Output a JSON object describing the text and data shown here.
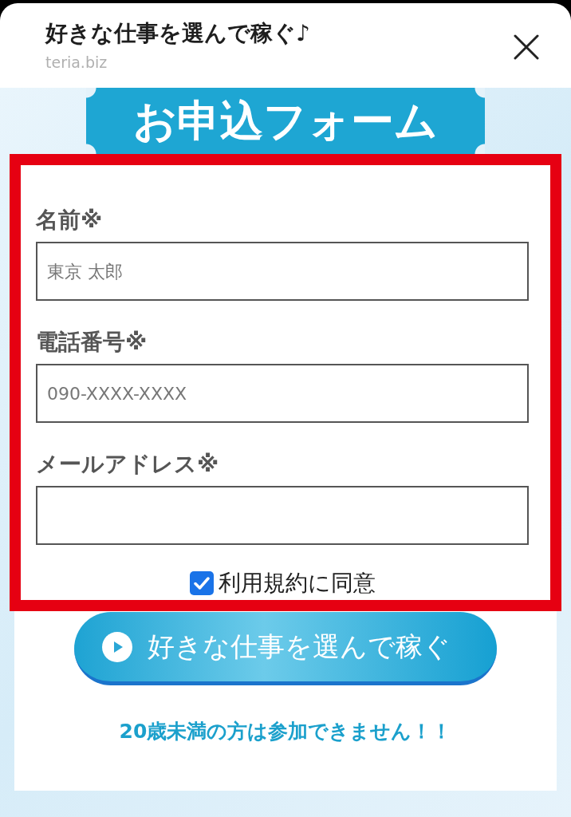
{
  "sheet": {
    "title": "好きな仕事を選んで稼ぐ♪",
    "url": "teria.biz"
  },
  "form": {
    "banner": "お申込フォーム",
    "fields": [
      {
        "label": "名前※",
        "placeholder": "東京 太郎"
      },
      {
        "label": "電話番号※",
        "placeholder": "090-XXXX-XXXX"
      },
      {
        "label": "メールアドレス※"
      }
    ],
    "agreement": {
      "label": "利用規約に同意",
      "checked": true
    }
  },
  "submit_button": {
    "label": "好きな仕事を選んで稼ぐ"
  },
  "notice": "20歳未満の方は参加できません！！"
}
